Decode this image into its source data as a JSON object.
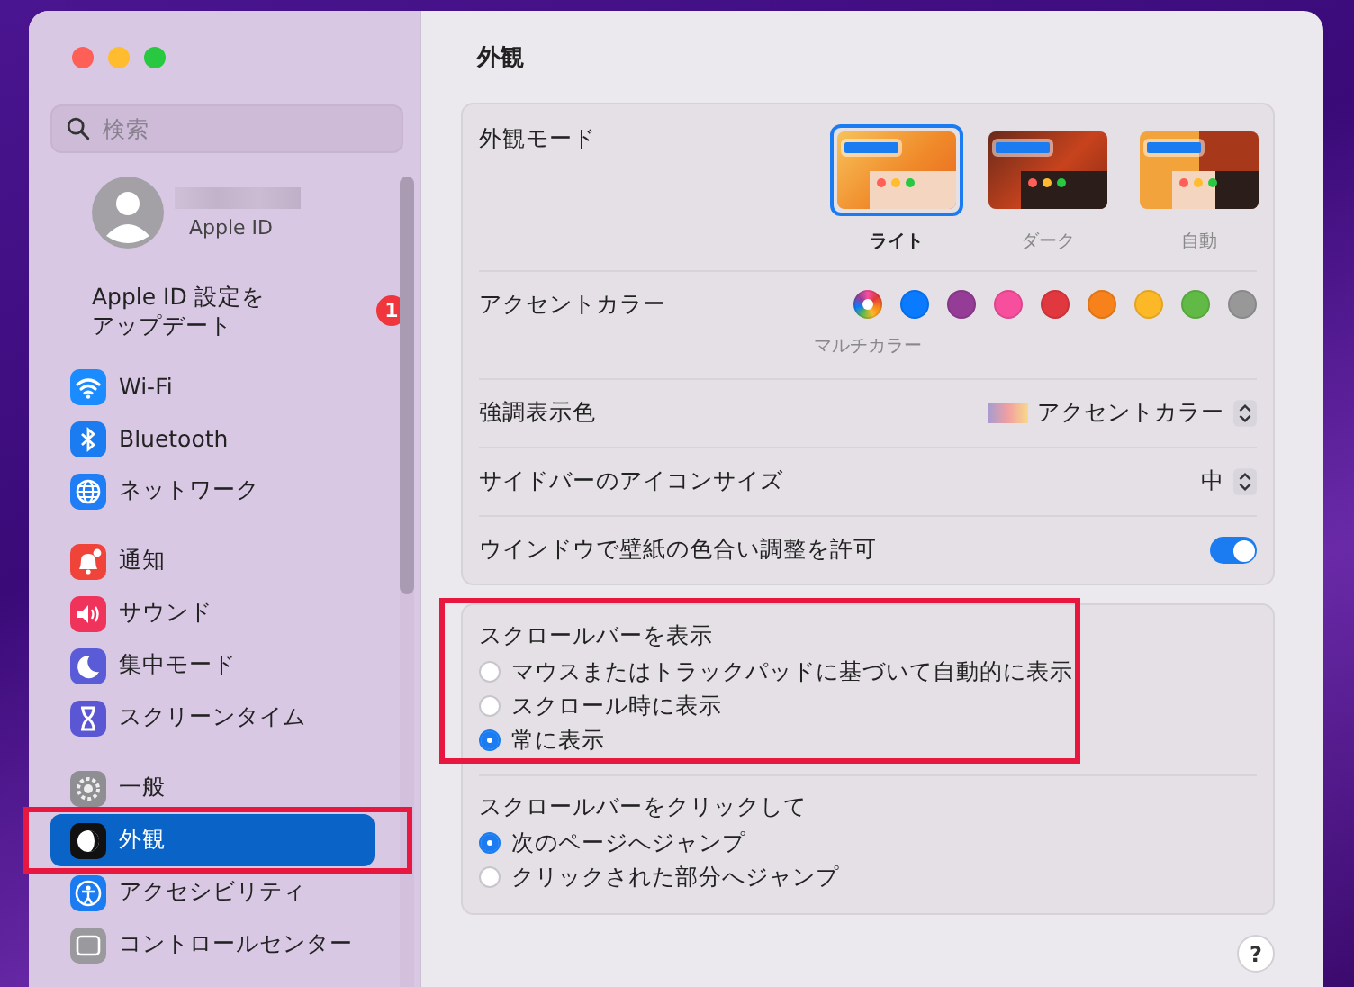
{
  "sidebar": {
    "search": {
      "placeholder": "検索"
    },
    "account": {
      "label": "Apple ID"
    },
    "update_notice": {
      "lines": [
        "Apple ID 設定を",
        "アップデート"
      ],
      "badge": "1"
    },
    "groups": [
      [
        {
          "label": "Wi-Fi",
          "selected": false
        },
        {
          "label": "Bluetooth",
          "selected": false
        },
        {
          "label": "ネットワーク",
          "selected": false
        }
      ],
      [
        {
          "label": "通知",
          "selected": false
        },
        {
          "label": "サウンド",
          "selected": false
        },
        {
          "label": "集中モード",
          "selected": false
        },
        {
          "label": "スクリーンタイム",
          "selected": false
        }
      ],
      [
        {
          "label": "一般",
          "selected": false
        },
        {
          "label": "外観",
          "selected": true
        },
        {
          "label": "アクセシビリティ",
          "selected": false
        },
        {
          "label": "コントロールセンター",
          "selected": false
        }
      ]
    ]
  },
  "content": {
    "title": "外観",
    "appearance_mode": {
      "label": "外観モード",
      "options": [
        {
          "label": "ライト",
          "selected": true
        },
        {
          "label": "ダーク",
          "selected": false
        },
        {
          "label": "自動",
          "selected": false
        }
      ]
    },
    "accent_color": {
      "label": "アクセントカラー",
      "caption": "マルチカラー",
      "swatches": [
        {
          "kind": "multicolor",
          "selected": true
        },
        {
          "kind": "solid",
          "color": "#0a7aff",
          "selected": false
        },
        {
          "kind": "solid",
          "color": "#953d96",
          "selected": false
        },
        {
          "kind": "solid",
          "color": "#f74f9e",
          "selected": false
        },
        {
          "kind": "solid",
          "color": "#e0383e",
          "selected": false
        },
        {
          "kind": "solid",
          "color": "#f7821b",
          "selected": false
        },
        {
          "kind": "solid",
          "color": "#fcb827",
          "selected": false
        },
        {
          "kind": "solid",
          "color": "#62ba46",
          "selected": false
        },
        {
          "kind": "solid",
          "color": "#989898",
          "selected": false
        }
      ]
    },
    "highlight_color": {
      "label": "強調表示色",
      "value": "アクセントカラー"
    },
    "sidebar_icon_size": {
      "label": "サイドバーのアイコンサイズ",
      "value": "中"
    },
    "wallpaper_tinting": {
      "label": "ウインドウで壁紙の色合い調整を許可",
      "on": true
    },
    "show_scroll_bars": {
      "label": "スクロールバーを表示",
      "options": [
        {
          "label": "マウスまたはトラックパッドに基づいて自動的に表示",
          "selected": false
        },
        {
          "label": "スクロール時に表示",
          "selected": false
        },
        {
          "label": "常に表示",
          "selected": true
        }
      ]
    },
    "click_scroll_bar": {
      "label": "スクロールバーをクリックして",
      "options": [
        {
          "label": "次のページへジャンプ",
          "selected": true
        },
        {
          "label": "クリックされた部分へジャンプ",
          "selected": false
        }
      ]
    },
    "help": "?"
  }
}
